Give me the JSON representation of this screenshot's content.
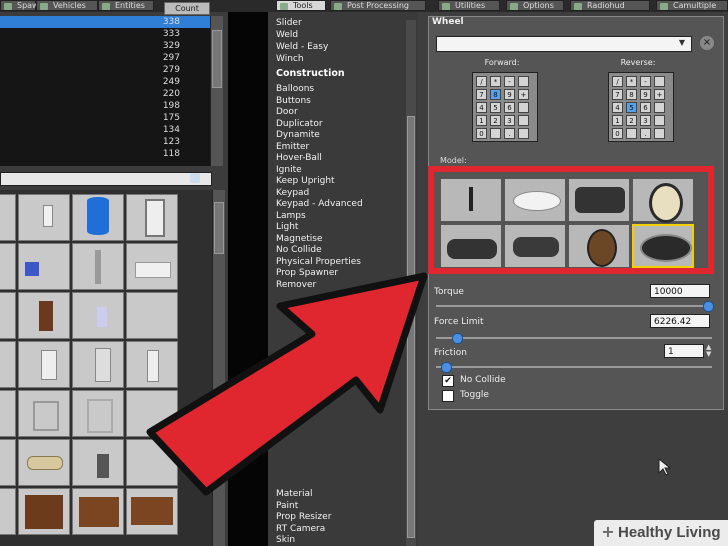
{
  "top_tabs": [
    {
      "label": "Spawnlists",
      "active": false
    },
    {
      "label": "Vehicles",
      "active": false
    },
    {
      "label": "Entities",
      "active": false
    },
    {
      "label": "Tools",
      "active": true
    },
    {
      "label": "Post Processing",
      "active": false
    },
    {
      "label": "Utilities",
      "active": false
    },
    {
      "label": "Options",
      "active": false
    },
    {
      "label": "Radiohud",
      "active": false
    },
    {
      "label": "Camultiple",
      "active": false
    }
  ],
  "left_list": {
    "header": "Count",
    "values": [
      "338",
      "333",
      "329",
      "297",
      "279",
      "249",
      "220",
      "198",
      "175",
      "134",
      "123",
      "118"
    ],
    "selected_index": 0
  },
  "tool_list": {
    "top_items": [
      "Slider",
      "Weld",
      "Weld - Easy",
      "Winch"
    ],
    "construction_header": "Construction",
    "construction_items": [
      "Balloons",
      "Buttons",
      "Door",
      "Duplicator",
      "Dynamite",
      "Emitter",
      "Hover-Ball",
      "Ignite",
      "Keep Upright",
      "Keypad",
      "Keypad - Advanced",
      "Lamps",
      "Light",
      "Magnetise",
      "No Collide",
      "Physical Properties",
      "Prop Spawner",
      "Remover"
    ],
    "bottom_items": [
      "Material",
      "Paint",
      "Prop Resizer",
      "RT Camera",
      "Skin"
    ]
  },
  "wheel": {
    "title": "Wheel",
    "dropdown_value": "",
    "forward_label": "Forward:",
    "reverse_label": "Reverse:",
    "forward_selected": "8",
    "reverse_selected": "5",
    "model_label": "Model:",
    "torque": {
      "label": "Torque",
      "value": "10000",
      "level": 1.0
    },
    "force_limit": {
      "label": "Force Limit",
      "value": "6226.42",
      "level": 0.06
    },
    "friction": {
      "label": "Friction",
      "value": "1",
      "level": 0.02
    },
    "no_collide": {
      "label": "No Collide",
      "checked": true
    },
    "toggle": {
      "label": "Toggle",
      "checked": false
    }
  },
  "keypad_keys": [
    [
      "/",
      "*",
      "-",
      ""
    ],
    [
      "7",
      "8",
      "9",
      "+"
    ],
    [
      "4",
      "5",
      "6",
      ""
    ],
    [
      "1",
      "2",
      "3",
      ""
    ],
    [
      "0",
      "",
      ".",
      ""
    ]
  ],
  "branding": {
    "text": "Healthy Living",
    "symbol": "+"
  },
  "colors": {
    "highlight_red": "#e0262f",
    "selection_blue": "#2f7fd6",
    "selected_model": "#f2d000"
  },
  "icons": [
    "arrow-pointer-graphic",
    "cursor-icon",
    "close-icon",
    "chevron-down-icon",
    "plus-icon"
  ]
}
